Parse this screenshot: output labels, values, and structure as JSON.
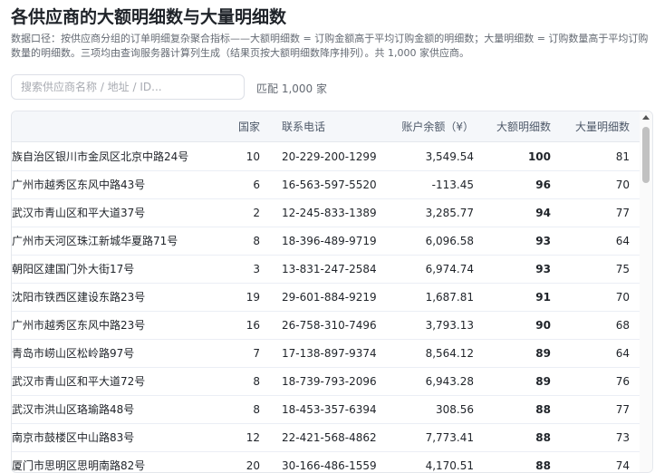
{
  "page": {
    "title": "各供应商的大额明细数与大量明细数",
    "description": "数据口径：按供应商分组的订单明细复杂聚合指标——大额明细数 = 订购金额高于平均订购金额的明细数；大量明细数 = 订购数量高于平均订购数量的明细数。三项均由查询服务器计算列生成（结果页按大额明细数降序排列）。共 1,000 家供应商。"
  },
  "search": {
    "placeholder": "搜索供应商名称 / 地址 / ID...",
    "match_text": "匹配 1,000 家"
  },
  "table": {
    "columns": {
      "address": "",
      "country": "国家",
      "phone": "联系电话",
      "balance": "账户余额（¥）",
      "big_count": "大额明细数",
      "qty_count": "大量明细数"
    },
    "rows": [
      {
        "address": "族自治区银川市金凤区北京中路24号",
        "country": "10",
        "phone": "20-229-200-1299",
        "balance": "3,549.54",
        "big_count": "100",
        "qty_count": "81"
      },
      {
        "address": "广州市越秀区东风中路43号",
        "country": "6",
        "phone": "16-563-597-5520",
        "balance": "-113.45",
        "big_count": "96",
        "qty_count": "70"
      },
      {
        "address": "武汉市青山区和平大道37号",
        "country": "2",
        "phone": "12-245-833-1389",
        "balance": "3,285.77",
        "big_count": "94",
        "qty_count": "77"
      },
      {
        "address": "广州市天河区珠江新城华夏路71号",
        "country": "8",
        "phone": "18-396-489-9719",
        "balance": "6,096.58",
        "big_count": "93",
        "qty_count": "64"
      },
      {
        "address": "朝阳区建国门外大街17号",
        "country": "3",
        "phone": "13-831-247-2584",
        "balance": "6,974.74",
        "big_count": "93",
        "qty_count": "75"
      },
      {
        "address": "沈阳市铁西区建设东路23号",
        "country": "19",
        "phone": "29-601-884-9219",
        "balance": "1,687.81",
        "big_count": "91",
        "qty_count": "70"
      },
      {
        "address": "广州市越秀区东风中路23号",
        "country": "16",
        "phone": "26-758-310-7496",
        "balance": "3,793.13",
        "big_count": "90",
        "qty_count": "68"
      },
      {
        "address": "青岛市崂山区松岭路97号",
        "country": "7",
        "phone": "17-138-897-9374",
        "balance": "8,564.12",
        "big_count": "89",
        "qty_count": "64"
      },
      {
        "address": "武汉市青山区和平大道72号",
        "country": "8",
        "phone": "18-739-793-2096",
        "balance": "6,943.28",
        "big_count": "89",
        "qty_count": "76"
      },
      {
        "address": "武汉市洪山区珞瑜路48号",
        "country": "8",
        "phone": "18-453-357-6394",
        "balance": "308.56",
        "big_count": "88",
        "qty_count": "77"
      },
      {
        "address": "南京市鼓楼区中山路83号",
        "country": "12",
        "phone": "22-421-568-4862",
        "balance": "7,773.41",
        "big_count": "88",
        "qty_count": "73"
      },
      {
        "address": "厦门市思明区思明南路82号",
        "country": "20",
        "phone": "30-166-486-1559",
        "balance": "4,170.51",
        "big_count": "88",
        "qty_count": "74"
      }
    ]
  }
}
